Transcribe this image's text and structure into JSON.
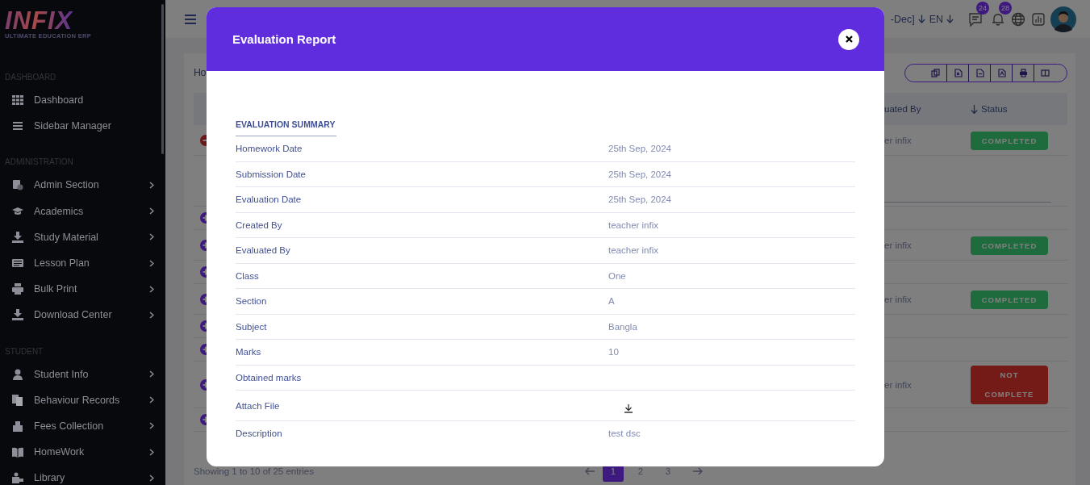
{
  "sidebar": {
    "logo": "INFIX",
    "tagline": "ULTIMATE EDUCATION ERP",
    "sections": [
      {
        "heading": "DASHBOARD",
        "items": [
          {
            "label": "Dashboard",
            "has_submenu": false
          },
          {
            "label": "Sidebar Manager",
            "has_submenu": false
          }
        ]
      },
      {
        "heading": "ADMINISTRATION",
        "items": [
          {
            "label": "Admin Section",
            "has_submenu": true
          },
          {
            "label": "Academics",
            "has_submenu": true
          },
          {
            "label": "Study Material",
            "has_submenu": true
          },
          {
            "label": "Lesson Plan",
            "has_submenu": true
          },
          {
            "label": "Bulk Print",
            "has_submenu": true
          },
          {
            "label": "Download Center",
            "has_submenu": true
          }
        ]
      },
      {
        "heading": "STUDENT",
        "items": [
          {
            "label": "Student Info",
            "has_submenu": true
          },
          {
            "label": "Behaviour Records",
            "has_submenu": true
          },
          {
            "label": "Fees Collection",
            "has_submenu": true
          },
          {
            "label": "HomeWork",
            "has_submenu": true
          },
          {
            "label": "Library",
            "has_submenu": true
          }
        ]
      }
    ]
  },
  "top_bar": {
    "session": "-Dec]",
    "language": "EN",
    "messages_count": "24",
    "notifications_count": "28"
  },
  "card": {
    "title": "Ho",
    "table": {
      "columns": [
        "uated By",
        "Status"
      ],
      "rows": [
        {
          "expanded": true,
          "evaluated_by": "er infix",
          "status": {
            "label": "COMPLETED",
            "kind": "completed"
          }
        },
        {
          "kind": "detail"
        },
        {
          "expanded": false
        },
        {
          "expanded": false,
          "evaluated_by": "er infix",
          "status": {
            "label": "COMPLETED",
            "kind": "completed"
          }
        },
        {
          "expanded": false
        },
        {
          "expanded": false,
          "evaluated_by": "er infix",
          "status": {
            "label": "COMPLETED",
            "kind": "completed"
          }
        },
        {
          "expanded": false
        },
        {
          "expanded": false
        },
        {
          "expanded": false,
          "evaluated_by": "er infix",
          "status": {
            "label": "NOT COMPLETE",
            "kind": "not_complete"
          }
        },
        {
          "expanded": false
        }
      ]
    },
    "footer": "Showing 1 to 10 of 25 entries",
    "pagination": [
      {
        "label": "1",
        "selected": true
      },
      {
        "label": "2",
        "selected": false
      },
      {
        "label": "3",
        "selected": false
      }
    ]
  },
  "modal": {
    "title": "Evaluation Report",
    "section": "EVALUATION SUMMARY",
    "rows": [
      {
        "label": "Homework Date",
        "value": "25th Sep, 2024"
      },
      {
        "label": "Submission Date",
        "value": "25th Sep, 2024"
      },
      {
        "label": "Evaluation Date",
        "value": "25th Sep, 2024"
      },
      {
        "label": "Created By",
        "value": "teacher infix"
      },
      {
        "label": "Evaluated By",
        "value": "teacher infix"
      },
      {
        "label": "Class",
        "value": "One"
      },
      {
        "label": "Section",
        "value": "A"
      },
      {
        "label": "Subject",
        "value": "Bangla"
      },
      {
        "label": "Marks",
        "value": "10"
      },
      {
        "label": "Obtained marks"
      },
      {
        "label": "Attach File",
        "kind": "file"
      },
      {
        "label": "Description",
        "value": "test dsc"
      }
    ]
  }
}
